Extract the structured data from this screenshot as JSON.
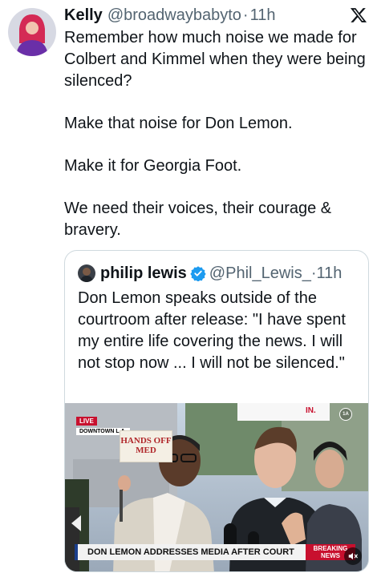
{
  "tweet": {
    "author_name": "Kelly",
    "author_handle": "@broadwaybabyto",
    "separator": "·",
    "time": "11h",
    "paragraphs": [
      "Remember how much noise we made for Colbert and Kimmel when they were being silenced?",
      "Make that noise for Don Lemon.",
      "Make it for Georgia Foot.",
      "We need their voices, their courage & bravery."
    ]
  },
  "quote": {
    "author_name": "philip lewis",
    "author_handle": "@Phil_Lewis_",
    "separator": "·",
    "time": "11h",
    "text": "Don Lemon speaks outside of the courtroom after release: \"I have spent my entire life covering the news. I will not stop now ... I will not be silenced.\"",
    "media": {
      "live_label": "LIVE",
      "location_label": "DOWNTOWN L.A.",
      "sign_text": "HANDS OFF MED",
      "network_badge": "1A",
      "chyron_text": "DON LEMON ADDRESSES MEDIA AFTER COURT",
      "breaking_label": "BREAKING NEWS"
    }
  },
  "icons": {
    "platform_logo": "x-logo-icon",
    "verified": "verified-badge-icon",
    "mute": "speaker-muted-icon"
  },
  "colors": {
    "text": "#0f1419",
    "secondary": "#536471",
    "border": "#cfd9de",
    "verified_blue": "#1d9bf0",
    "breaking_red": "#c8102e"
  }
}
